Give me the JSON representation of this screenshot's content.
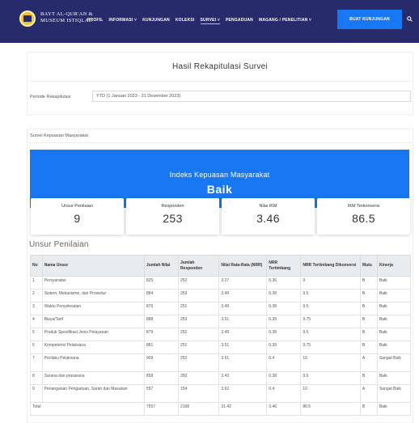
{
  "nav": {
    "brand_line1": "BAYT AL-QUR'AN &",
    "brand_line2": "MUSEUM ISTIQLAL",
    "items": [
      {
        "label": "PROFIL"
      },
      {
        "label": "INFORMASI ˅"
      },
      {
        "label": "KUNJUNGAN"
      },
      {
        "label": "KOLEKSI"
      },
      {
        "label": "SURVEI ˅"
      },
      {
        "label": "PENGADUAN"
      },
      {
        "label": "MAGANG / PENELITIAN ˅"
      }
    ],
    "cta_label": "BUAT KUNJUNGAN",
    "search_icon": "search-icon"
  },
  "header": {
    "title": "Hasil Rekapitulasi Survei",
    "period_label": "Periode Rekapitulasi",
    "period_value": "YTD (1 Januari 2023 - 31 Desember 2023)"
  },
  "survey": {
    "card_title": "Survei Kepuasan Masyarakat",
    "banner_title": "Indeks Kepuasan Masyarakat",
    "banner_value": "Baik",
    "stats": [
      {
        "label": "Unsur Penilaian",
        "value": "9"
      },
      {
        "label": "Responden",
        "value": "253"
      },
      {
        "label": "Nilai IKM",
        "value": "3.46"
      },
      {
        "label": "IKM Terkonversi",
        "value": "86.5"
      }
    ],
    "section_title": "Unsur Penilaian",
    "columns": [
      "No",
      "Nama Unsur",
      "Jumlah Nilai",
      "Jumlah Responden",
      "Nilai Rata-Rata (NRR)",
      "NRR Tertimbang",
      "NRR Tertimbang Dikonversi",
      "Mutu",
      "Kinerja"
    ],
    "rows": [
      [
        "1",
        "Persyaratan",
        "825",
        "252",
        "3.27",
        "0.36",
        "9",
        "B",
        "Baik"
      ],
      [
        "2",
        "Sistem, Mekanisme, dan Prosedur",
        "884",
        "253",
        "3.49",
        "0.38",
        "9.5",
        "B",
        "Baik"
      ],
      [
        "3",
        "Waktu Penyelesaian",
        "876",
        "251",
        "3.49",
        "0.38",
        "9.5",
        "B",
        "Baik"
      ],
      [
        "4",
        "Biaya/Tarif",
        "888",
        "253",
        "3.51",
        "0.39",
        "9.75",
        "B",
        "Baik"
      ],
      [
        "5",
        "Produk Spesifikasi Jenis Pelayanan",
        "879",
        "252",
        "3.49",
        "0.38",
        "9.5",
        "B",
        "Baik"
      ],
      [
        "6",
        "Kompetensi Pelaksana",
        "881",
        "251",
        "3.51",
        "0.39",
        "9.75",
        "B",
        "Baik"
      ],
      [
        "7",
        "Perilaku Pelaksana",
        "909",
        "252",
        "3.61",
        "0.4",
        "10",
        "A",
        "Sangat Baik"
      ],
      [
        "8",
        "Sarana dan prasarana",
        "858",
        "250",
        "3.43",
        "0.38",
        "9.5",
        "B",
        "Baik"
      ],
      [
        "9",
        "Penanganan Pengaduan, Saran dan Masukan",
        "557",
        "154",
        "3.62",
        "0.4",
        "10",
        "A",
        "Sangat Baik"
      ]
    ],
    "total": [
      "Total",
      "7557",
      "2168",
      "31.42",
      "3.46",
      "86.5",
      "B",
      "Baik"
    ]
  },
  "colors": {
    "navbar": "#272a6b",
    "accent_blue": "#1877f2",
    "logo_gold": "#f3c12c"
  }
}
